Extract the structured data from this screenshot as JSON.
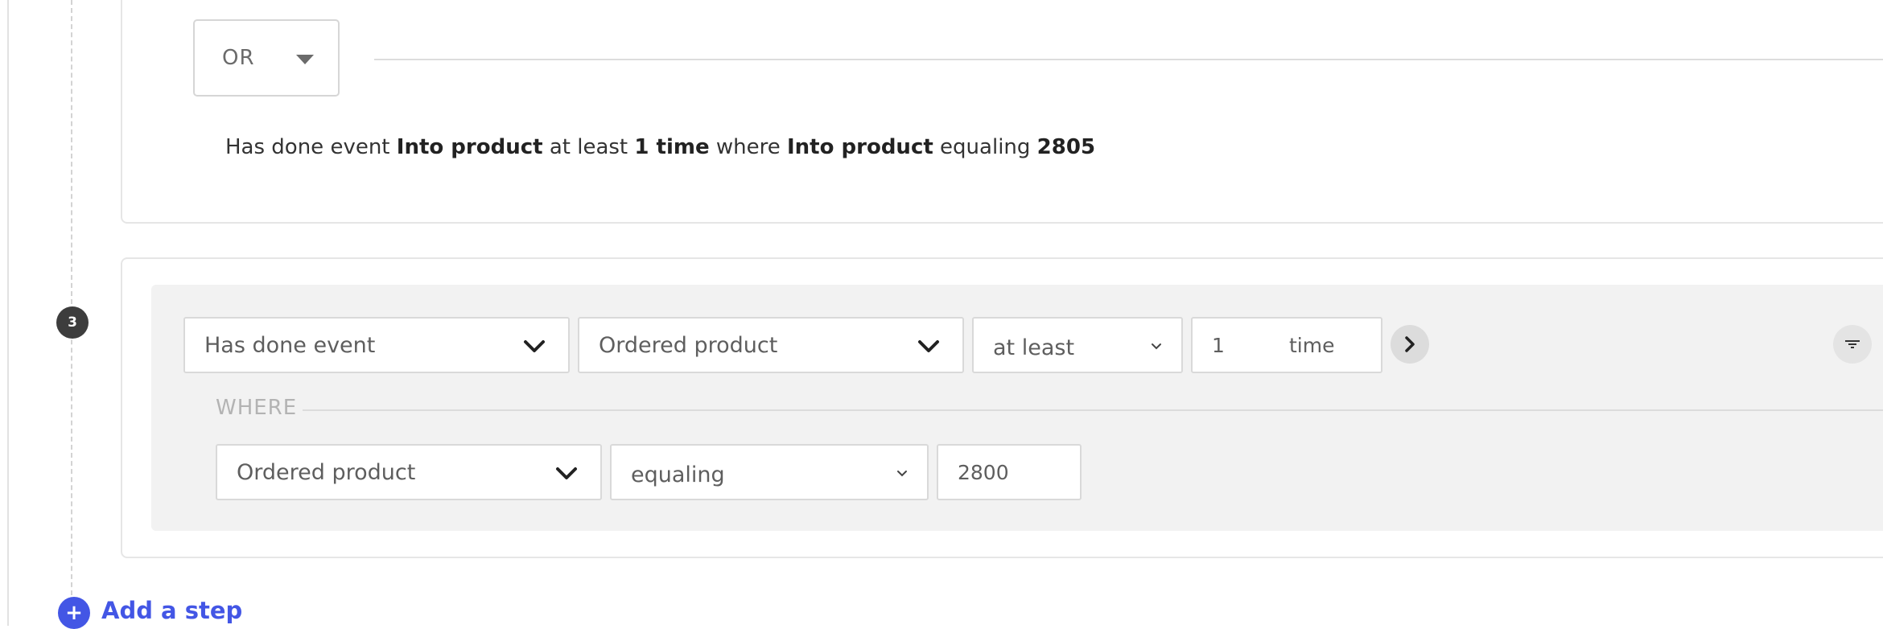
{
  "group": {
    "combinator_label": "OR",
    "summary": {
      "prefix": "Has done event ",
      "event": "Into product",
      "mid1": " at least ",
      "count": "1 time",
      "mid2": " where ",
      "property": "Into product",
      "mid3": " equaling ",
      "value": "2805"
    }
  },
  "step": {
    "number": "3",
    "condition": {
      "type_label": "Has done event",
      "event_label": "Ordered product",
      "frequency_label": "at least",
      "count_value": "1",
      "count_unit": "time"
    },
    "where": {
      "label": "WHERE",
      "property_label": "Ordered product",
      "operator_label": "equaling",
      "value": "2800"
    }
  },
  "footer": {
    "add_step_label": "Add a step"
  },
  "icons": {
    "chevron_down": "chevron-down-icon",
    "chevron_right": "chevron-right-icon",
    "sort": "sort-icon",
    "plus": "plus-icon"
  },
  "colors": {
    "accent": "#4356e5",
    "badge": "#3d3d3d",
    "panel": "#f2f2f2"
  }
}
